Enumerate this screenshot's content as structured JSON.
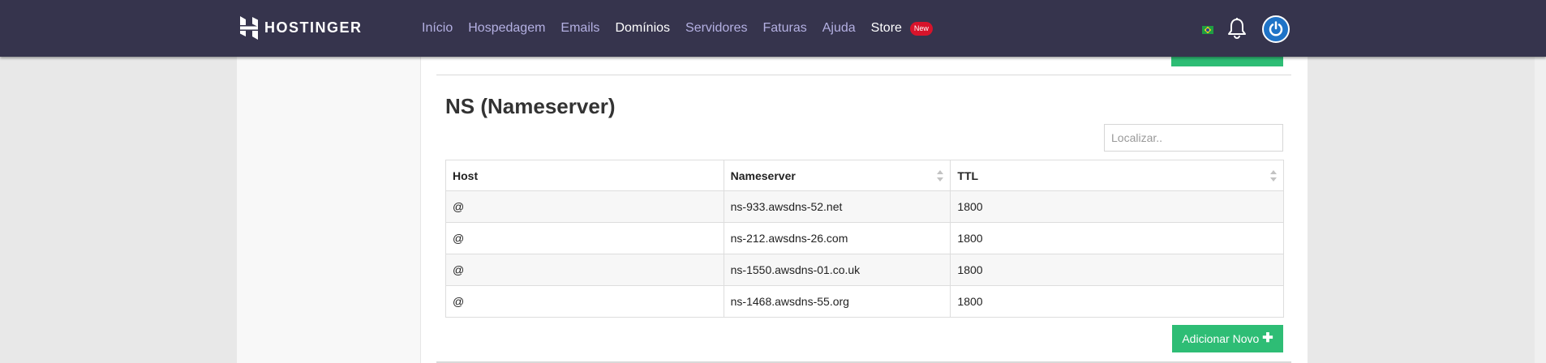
{
  "brand": {
    "name": "HOSTINGER"
  },
  "nav": {
    "items": [
      {
        "label": "Início"
      },
      {
        "label": "Hospedagem"
      },
      {
        "label": "Emails"
      },
      {
        "label": "Domínios",
        "active": true
      },
      {
        "label": "Servidores"
      },
      {
        "label": "Faturas"
      },
      {
        "label": "Ajuda"
      }
    ],
    "store": {
      "label": "Store",
      "badge": "New"
    }
  },
  "header_icons": {
    "flag": "brazil-flag-icon",
    "notifications": "bell-icon",
    "account": "power-icon"
  },
  "section": {
    "title": "NS (Nameserver)",
    "search_placeholder": "Localizar.."
  },
  "table": {
    "columns": [
      "Host",
      "Nameserver",
      "TTL"
    ],
    "rows": [
      {
        "host": "@",
        "nameserver": "ns-933.awsdns-52.net",
        "ttl": "1800"
      },
      {
        "host": "@",
        "nameserver": "ns-212.awsdns-26.com",
        "ttl": "1800"
      },
      {
        "host": "@",
        "nameserver": "ns-1550.awsdns-01.co.uk",
        "ttl": "1800"
      },
      {
        "host": "@",
        "nameserver": "ns-1468.awsdns-55.org",
        "ttl": "1800"
      }
    ]
  },
  "add_button": {
    "label": "Adicionar Novo",
    "icon": "plus-icon"
  },
  "colors": {
    "topbar": "#36344d",
    "nav_link": "#b4b0e2",
    "accent_green": "#2ebd75",
    "badge_red": "#d8132b",
    "account_blue": "#1f73c7"
  }
}
